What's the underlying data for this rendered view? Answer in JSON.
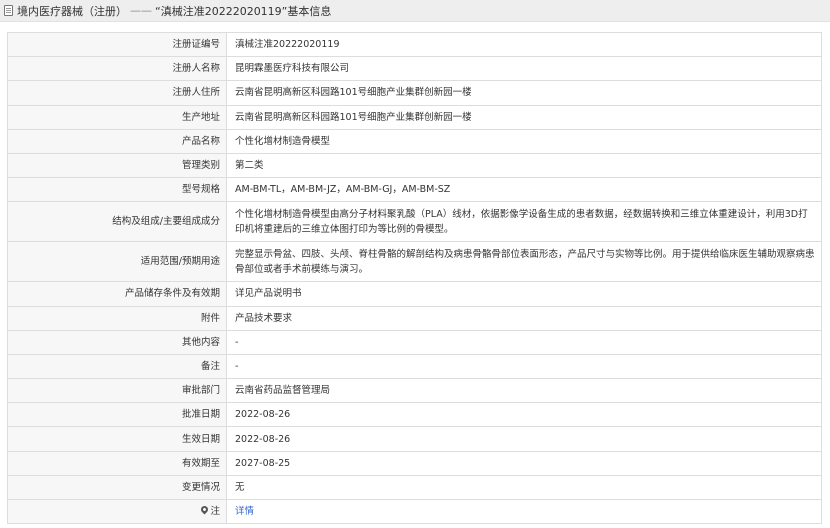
{
  "header": {
    "prefix": "境内医疗器械（注册）",
    "separator": "——",
    "title": "“滇械注准20222020119”基本信息"
  },
  "rows": [
    {
      "label": "注册证编号",
      "value": "滇械注准20222020119"
    },
    {
      "label": "注册人名称",
      "value": "昆明霖墨医疗科技有限公司"
    },
    {
      "label": "注册人住所",
      "value": "云南省昆明高新区科园路101号细胞产业集群创新园一楼"
    },
    {
      "label": "生产地址",
      "value": "云南省昆明高新区科园路101号细胞产业集群创新园一楼"
    },
    {
      "label": "产品名称",
      "value": "个性化增材制造骨模型"
    },
    {
      "label": "管理类别",
      "value": "第二类"
    },
    {
      "label": "型号规格",
      "value": "AM-BM-TL，AM-BM-JZ，AM-BM-GJ，AM-BM-SZ"
    },
    {
      "label": "结构及组成/主要组成成分",
      "value": "个性化增材制造骨模型由高分子材料聚乳酸（PLA）线材，依据影像学设备生成的患者数据，经数据转换和三维立体重建设计，利用3D打印机将重建后的三维立体图打印为等比例的骨模型。"
    },
    {
      "label": "适用范围/预期用途",
      "value": "完整显示骨盆、四肢、头颅、脊柱骨骼的解剖结构及病患骨骼骨部位表面形态，产品尺寸与实物等比例。用于提供给临床医生辅助观察病患骨部位或者手术前模练与演习。"
    },
    {
      "label": "产品储存条件及有效期",
      "value": "详见产品说明书"
    },
    {
      "label": "附件",
      "value": "产品技术要求"
    },
    {
      "label": "其他内容",
      "value": "-"
    },
    {
      "label": "备注",
      "value": "-"
    },
    {
      "label": "审批部门",
      "value": "云南省药品监督管理局"
    },
    {
      "label": "批准日期",
      "value": "2022-08-26"
    },
    {
      "label": "生效日期",
      "value": "2022-08-26"
    },
    {
      "label": "有效期至",
      "value": "2027-08-25"
    },
    {
      "label": "变更情况",
      "value": "无"
    }
  ],
  "note_row": {
    "label": "注",
    "link": "详情",
    "icon": "pin-icon"
  }
}
